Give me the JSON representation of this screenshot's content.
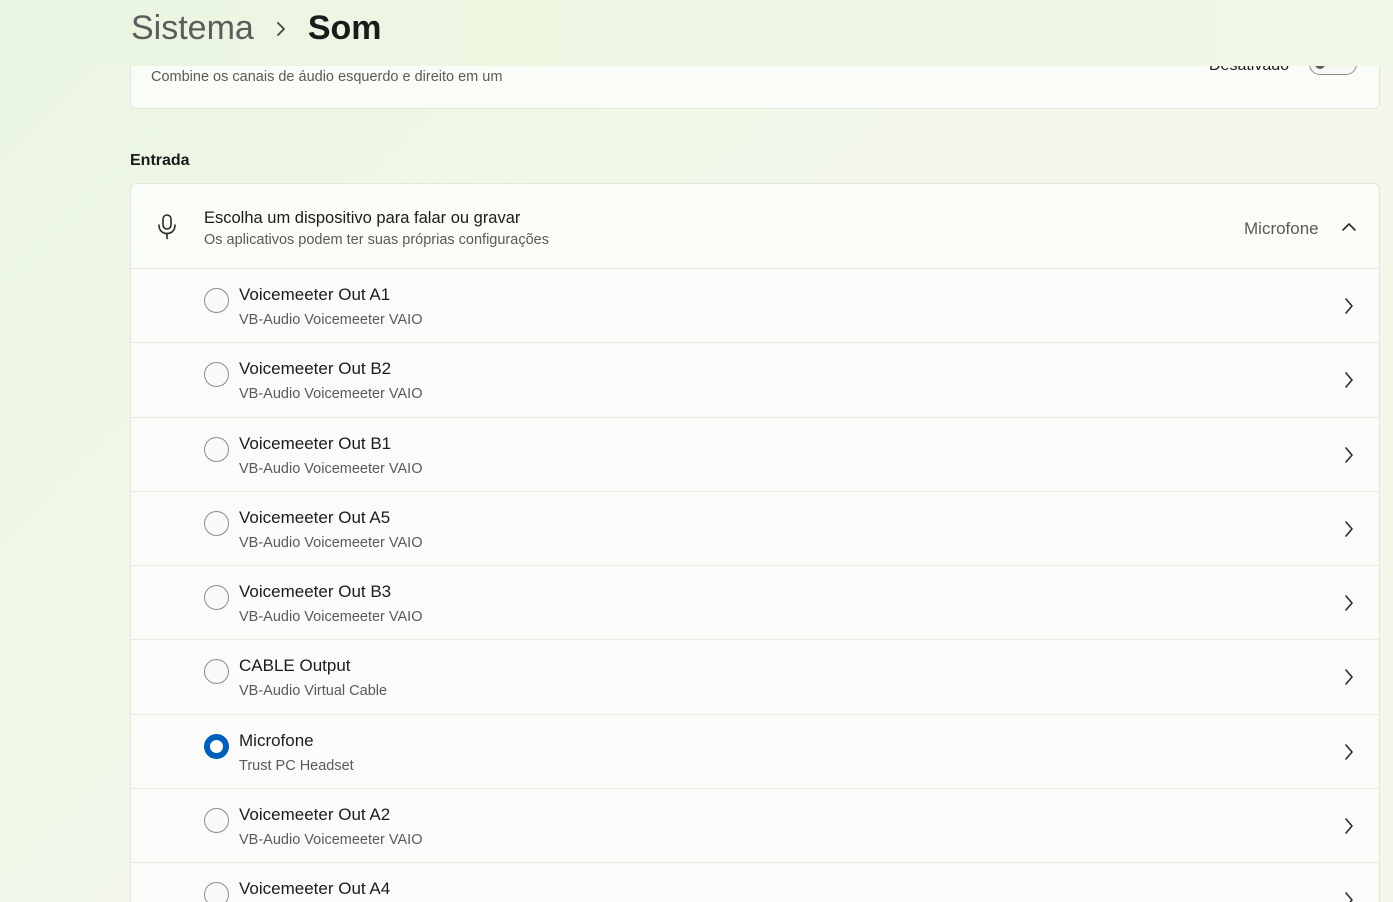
{
  "breadcrumb": {
    "parent": "Sistema",
    "current": "Som"
  },
  "mono_audio": {
    "description": "Combine os canais de áudio esquerdo e direito em um",
    "toggle_state": "Desativado",
    "enabled": false
  },
  "input_section": {
    "title": "Entrada",
    "chooser": {
      "title": "Escolha um dispositivo para falar ou gravar",
      "subtitle": "Os aplicativos podem ter suas próprias configurações",
      "selected_value": "Microfone",
      "expanded": true
    },
    "devices": [
      {
        "name": "Voicemeeter Out A1",
        "driver": "VB-Audio Voicemeeter VAIO",
        "selected": false
      },
      {
        "name": "Voicemeeter Out B2",
        "driver": "VB-Audio Voicemeeter VAIO",
        "selected": false
      },
      {
        "name": "Voicemeeter Out B1",
        "driver": "VB-Audio Voicemeeter VAIO",
        "selected": false
      },
      {
        "name": "Voicemeeter Out A5",
        "driver": "VB-Audio Voicemeeter VAIO",
        "selected": false
      },
      {
        "name": "Voicemeeter Out B3",
        "driver": "VB-Audio Voicemeeter VAIO",
        "selected": false
      },
      {
        "name": "CABLE Output",
        "driver": "VB-Audio Virtual Cable",
        "selected": false
      },
      {
        "name": "Microfone",
        "driver": "Trust PC Headset",
        "selected": true
      },
      {
        "name": "Voicemeeter Out A2",
        "driver": "VB-Audio Voicemeeter VAIO",
        "selected": false
      },
      {
        "name": "Voicemeeter Out A4",
        "driver": "",
        "selected": false
      }
    ]
  },
  "colors": {
    "accent": "#005fb8",
    "background": "#eef7e3"
  },
  "icons": {
    "breadcrumb_separator": "chevron-right-icon",
    "input_device": "microphone-icon",
    "collapse": "chevron-up-icon",
    "row_open": "chevron-right-icon"
  }
}
